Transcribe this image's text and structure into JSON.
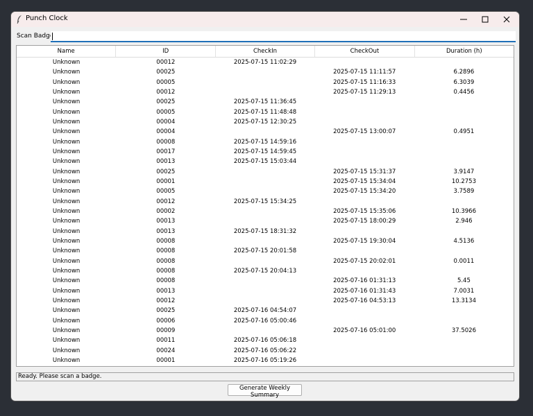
{
  "window": {
    "title": "Punch Clock"
  },
  "scan": {
    "label": "Scan Badge:",
    "value": ""
  },
  "table": {
    "columns": [
      "Name",
      "ID",
      "CheckIn",
      "CheckOut",
      "Duration (h)"
    ],
    "rows": [
      [
        "Unknown",
        "00012",
        "2025-07-15 11:02:29",
        "",
        ""
      ],
      [
        "Unknown",
        "00025",
        "",
        "2025-07-15 11:11:57",
        "6.2896"
      ],
      [
        "Unknown",
        "00005",
        "",
        "2025-07-15 11:16:33",
        "6.3039"
      ],
      [
        "Unknown",
        "00012",
        "",
        "2025-07-15 11:29:13",
        "0.4456"
      ],
      [
        "Unknown",
        "00025",
        "2025-07-15 11:36:45",
        "",
        ""
      ],
      [
        "Unknown",
        "00005",
        "2025-07-15 11:48:48",
        "",
        ""
      ],
      [
        "Unknown",
        "00004",
        "2025-07-15 12:30:25",
        "",
        ""
      ],
      [
        "Unknown",
        "00004",
        "",
        "2025-07-15 13:00:07",
        "0.4951"
      ],
      [
        "Unknown",
        "00008",
        "2025-07-15 14:59:16",
        "",
        ""
      ],
      [
        "Unknown",
        "00017",
        "2025-07-15 14:59:45",
        "",
        ""
      ],
      [
        "Unknown",
        "00013",
        "2025-07-15 15:03:44",
        "",
        ""
      ],
      [
        "Unknown",
        "00025",
        "",
        "2025-07-15 15:31:37",
        "3.9147"
      ],
      [
        "Unknown",
        "00001",
        "",
        "2025-07-15 15:34:04",
        "10.2753"
      ],
      [
        "Unknown",
        "00005",
        "",
        "2025-07-15 15:34:20",
        "3.7589"
      ],
      [
        "Unknown",
        "00012",
        "2025-07-15 15:34:25",
        "",
        ""
      ],
      [
        "Unknown",
        "00002",
        "",
        "2025-07-15 15:35:06",
        "10.3966"
      ],
      [
        "Unknown",
        "00013",
        "",
        "2025-07-15 18:00:29",
        "2.946"
      ],
      [
        "Unknown",
        "00013",
        "2025-07-15 18:31:32",
        "",
        ""
      ],
      [
        "Unknown",
        "00008",
        "",
        "2025-07-15 19:30:04",
        "4.5136"
      ],
      [
        "Unknown",
        "00008",
        "2025-07-15 20:01:58",
        "",
        ""
      ],
      [
        "Unknown",
        "00008",
        "",
        "2025-07-15 20:02:01",
        "0.0011"
      ],
      [
        "Unknown",
        "00008",
        "2025-07-15 20:04:13",
        "",
        ""
      ],
      [
        "Unknown",
        "00008",
        "",
        "2025-07-16 01:31:13",
        "5.45"
      ],
      [
        "Unknown",
        "00013",
        "",
        "2025-07-16 01:31:43",
        "7.0031"
      ],
      [
        "Unknown",
        "00012",
        "",
        "2025-07-16 04:53:13",
        "13.3134"
      ],
      [
        "Unknown",
        "00025",
        "2025-07-16 04:54:07",
        "",
        ""
      ],
      [
        "Unknown",
        "00006",
        "2025-07-16 05:00:46",
        "",
        ""
      ],
      [
        "Unknown",
        "00009",
        "",
        "2025-07-16 05:01:00",
        "37.5026"
      ],
      [
        "Unknown",
        "00011",
        "2025-07-16 05:06:18",
        "",
        ""
      ],
      [
        "Unknown",
        "00024",
        "2025-07-16 05:06:22",
        "",
        ""
      ],
      [
        "Unknown",
        "00001",
        "2025-07-16 05:19:26",
        "",
        ""
      ]
    ]
  },
  "status": {
    "text": "Ready. Please scan a badge."
  },
  "actions": {
    "summary_label": "Generate Weekly Summary"
  },
  "icons": {
    "app": "feather-icon",
    "minimize": "minimize-icon",
    "maximize": "maximize-icon",
    "close": "close-icon"
  },
  "colors": {
    "accent": "#1f6fb8",
    "titlebar": "#f7ecec",
    "window_bg": "#f0f0f0",
    "desktop": "#2b2f36"
  }
}
